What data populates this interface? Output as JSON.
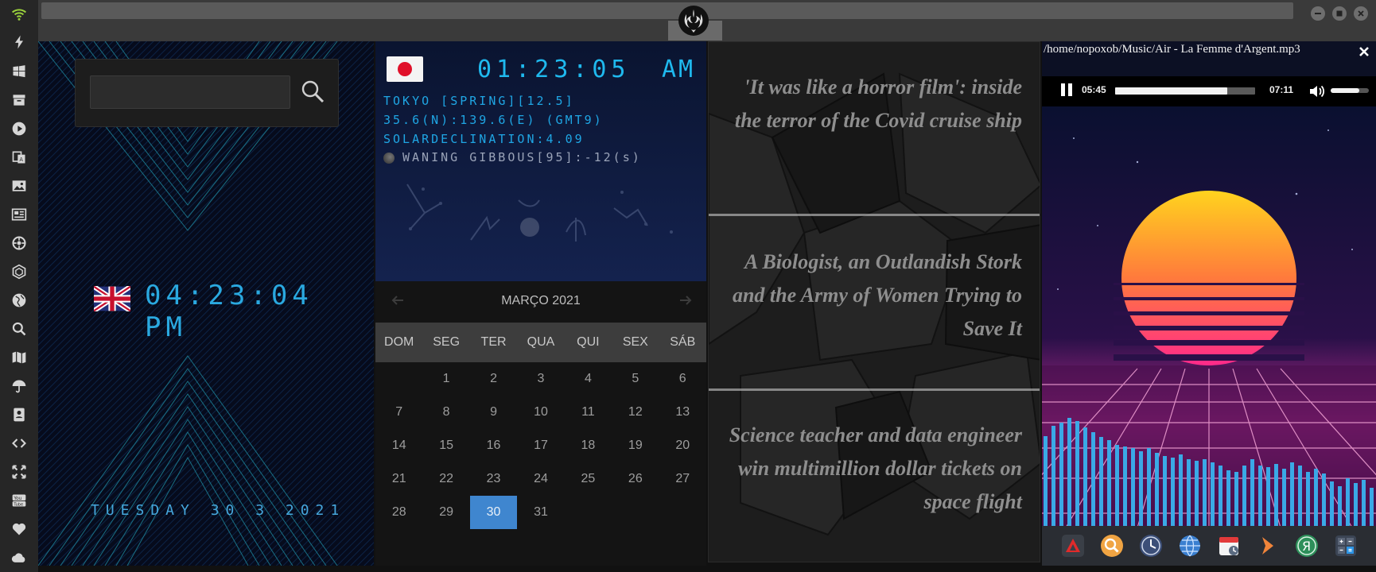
{
  "clock": {
    "search_placeholder": "",
    "uk_time": "04:23:04 PM",
    "date_line": "TUESDAY 30 3 2021"
  },
  "world_clock": {
    "time": "01:23:05",
    "ampm": "AM",
    "line1": "TOKYO [SPRING][12.5]",
    "line2": "35.6(N):139.6(E) (GMT9)",
    "line3": "SOLARDECLINATION:4.09",
    "moon": "WANING GIBBOUS[95]:-12(s)"
  },
  "calendar": {
    "title": "MARÇO 2021",
    "weekdays": [
      "DOM",
      "SEG",
      "TER",
      "QUA",
      "QUI",
      "SEX",
      "SÁB"
    ],
    "weeks": [
      [
        "",
        "1",
        "2",
        "3",
        "4",
        "5",
        "6"
      ],
      [
        "7",
        "8",
        "9",
        "10",
        "11",
        "12",
        "13"
      ],
      [
        "14",
        "15",
        "16",
        "17",
        "18",
        "19",
        "20"
      ],
      [
        "21",
        "22",
        "23",
        "24",
        "25",
        "26",
        "27"
      ],
      [
        "28",
        "29",
        "30",
        "31",
        "",
        "",
        ""
      ]
    ],
    "today": "30"
  },
  "news": [
    "'It was like a horror film': inside the terror of the Covid cruise ship",
    "A Biologist, an Outlandish Stork and the Army of Women Trying to Save It",
    "Science teacher and data engineer win multimillion dollar tickets on space flight"
  ],
  "player": {
    "path": "/home/nopoxob/Music/Air - La Femme d'Argent.mp3",
    "elapsed": "05:45",
    "total": "07:11",
    "progress": 0.8,
    "volume": 0.75
  },
  "sidebar": {
    "icons": [
      "wifi-icon",
      "flash-icon",
      "windows-icon",
      "archive-icon",
      "play-icon",
      "translate-icon",
      "image-icon",
      "newspaper-icon",
      "settings-icon",
      "hexagon-icon",
      "globe-icon",
      "search-icon",
      "map-icon",
      "umbrella-icon",
      "contacts-icon",
      "code-icon",
      "expand-icon",
      "youtube-icon",
      "heart-icon",
      "cloud-icon"
    ]
  },
  "dock": {
    "apps": [
      "app-launcher-icon",
      "magnifier-icon",
      "clock-icon",
      "globe-icon",
      "calendar-icon",
      "forward-icon",
      "yandex-icon",
      "calculator-icon"
    ]
  },
  "colors": {
    "accent": "#1fb9ee",
    "today_highlight": "#3f86cf"
  }
}
